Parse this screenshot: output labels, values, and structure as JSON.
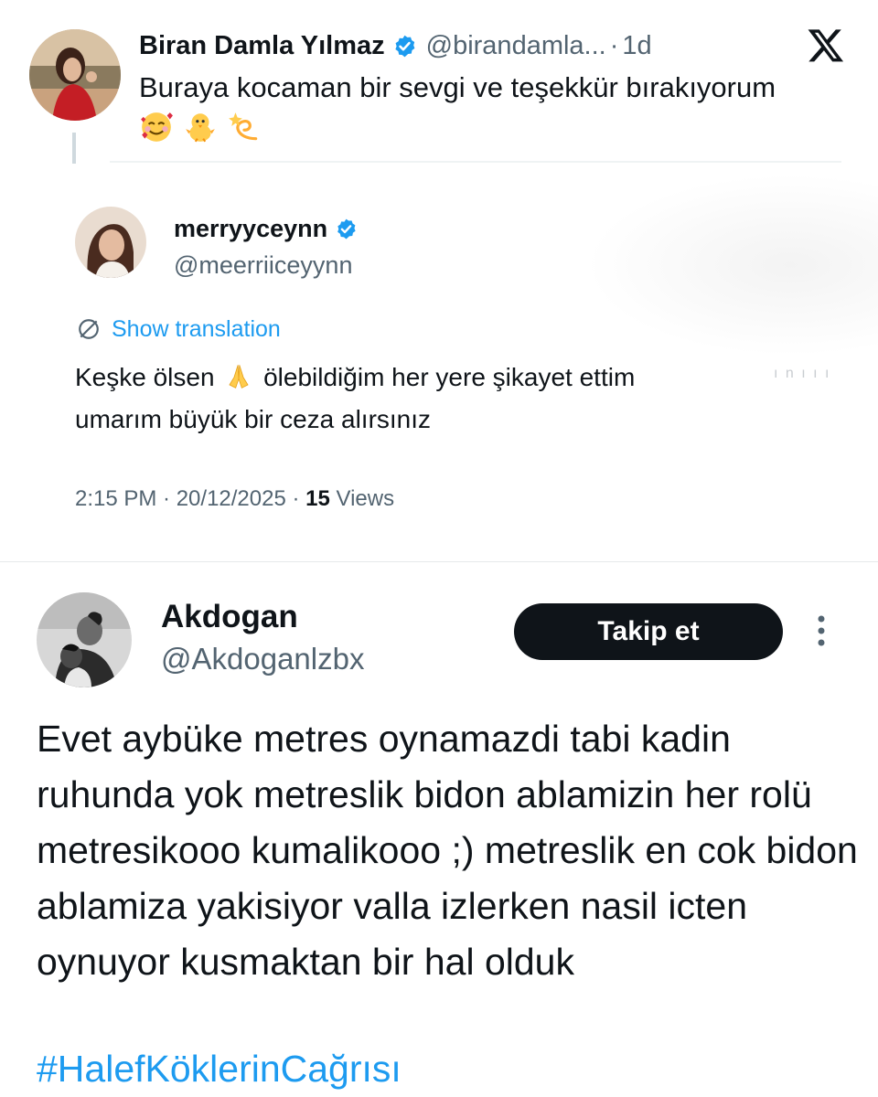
{
  "reply_tweet": {
    "author_name": "Biran Damla Yılmaz",
    "handle": "@birandamla...",
    "separator": "·",
    "time": "1d",
    "text": "Buraya kocaman bir sevgi ve teşekkür bırakıyorum",
    "emojis": [
      "smiling-face-with-hearts-emoji",
      "hatching-chick-emoji",
      "dizzy-emoji"
    ]
  },
  "quoted_tweet": {
    "author_name": "merryyceynn",
    "handle": "@meerriiceyynn",
    "translate_label": "Show translation",
    "text_part1": "Keşke ölsen",
    "text_part2": "ölebildiğim her yere şikayet ettim",
    "text_line2": "umarım büyük bir ceza alırsınız",
    "ghost_text": "ı n ı ı ı",
    "meta_time": "2:15 PM · 20/12/2025 · ",
    "views_count": "15",
    "views_label": " Views"
  },
  "main_tweet": {
    "author_name": "Akdogan",
    "handle": "@Akdoganlzbx",
    "follow_label": "Takip et",
    "text": "Evet aybüke metres oynamazdi tabi kadin ruhunda yok metreslik bidon ablamizin her rolü metresikooo kumalikooo ;) metreslik en cok bidon ablamiza yakisiyor valla izlerken nasil icten oynuyor kusmaktan bir hal olduk",
    "hashtag": "#HalefKöklerinCağrısı"
  },
  "colors": {
    "accent": "#1d9bf0",
    "text": "#0f1419",
    "muted": "#536471",
    "button_bg": "#0f1419"
  },
  "icons": [
    "verified-badge-icon",
    "x-logo-icon",
    "globe-icon",
    "more-vertical-icon",
    "folded-hands-emoji"
  ]
}
